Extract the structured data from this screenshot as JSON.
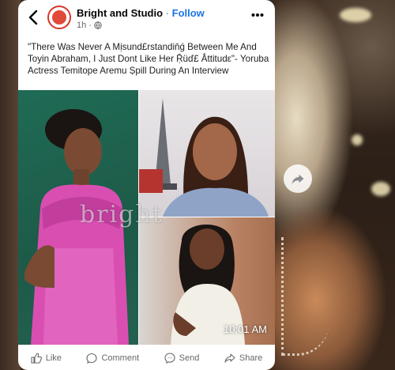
{
  "post": {
    "page_name": "Bright and Studio",
    "separator": "·",
    "follow_label": "Follow",
    "age": "1h",
    "meta_separator": "·",
    "caption": "\"There Was Never A Mịsund£rstandiňǵ Between Me And Toyin Abraham, I Just Dont Like Her Ṝüď£ Ắttitudε\"- Yoruba Actress Temitope Aremu Ṣpill During An Interview",
    "watermark": "bright",
    "timestamp": "10:01 AM"
  },
  "actions": [
    {
      "icon": "like-icon",
      "label": "Like"
    },
    {
      "icon": "comment-icon",
      "label": "Comment"
    },
    {
      "icon": "send-icon",
      "label": "Send"
    },
    {
      "icon": "share-icon",
      "label": "Share"
    }
  ],
  "colors": {
    "follow": "#1b74e4",
    "meta": "#65676b",
    "avatar_ring": "#d9362b"
  }
}
